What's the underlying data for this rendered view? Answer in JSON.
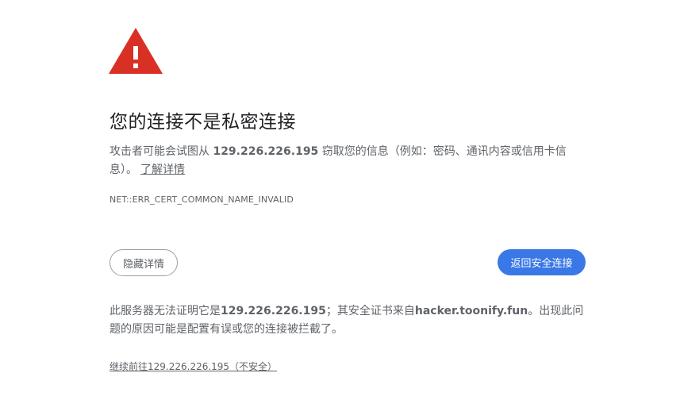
{
  "icon": {
    "name": "warning-triangle-icon",
    "color": "#d93025"
  },
  "heading": "您的连接不是私密连接",
  "description": {
    "prefix": "攻击者可能会试图从 ",
    "host": "129.226.226.195",
    "suffix": " 窃取您的信息（例如：密码、通讯内容或信用卡信息）。",
    "learn_more": "了解详情"
  },
  "error_code": "NET::ERR_CERT_COMMON_NAME_INVALID",
  "buttons": {
    "details": "隐藏详情",
    "back_to_safety": "返回安全连接"
  },
  "details": {
    "part1": "此服务器无法证明它是",
    "host": "129.226.226.195",
    "part2": "；其安全证书来自",
    "cert_domain": "hacker.toonify.fun",
    "part3": "。出现此问题的原因可能是配置有误或您的连接被拦截了。"
  },
  "proceed_link": "继续前往129.226.226.195（不安全）",
  "colors": {
    "primary_button": "#3b78e7",
    "warning": "#d93025",
    "text": "#5f6368"
  }
}
